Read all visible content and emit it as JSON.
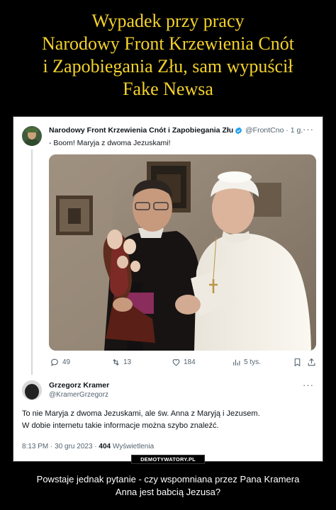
{
  "meme": {
    "title_lines": [
      "Wypadek przy pracy",
      "Narodowy Front Krzewienia Cnót",
      "i Zapobiegania Złu, sam wypuścił",
      "Fake Newsa"
    ],
    "watermark": "DEMOTYWATORY.PL",
    "caption_lines": [
      "Powstaje jednak pytanie - czy wspomniana przez Pana Kramera",
      "Anna jest babcią Jezusa?"
    ]
  },
  "tweet1": {
    "author_name": "Narodowy Front Krzewienia Cnót i Zapobiegania Złu",
    "handle_time": "@FrontCno · 1 g.",
    "more": "···",
    "text": "- Boom! Maryja z dwoma Jezuskami!",
    "stats": {
      "replies": "49",
      "reposts": "13",
      "likes": "184",
      "views": "5 tys."
    },
    "icons": [
      "reply-icon",
      "repost-icon",
      "like-icon",
      "views-icon",
      "bookmark-icon",
      "share-icon"
    ]
  },
  "tweet2": {
    "author_name": "Grzegorz Kramer",
    "handle": "@KramerGrzegorz",
    "more": "···",
    "text_lines": [
      "To nie Maryja z dwoma Jezuskami, ale św. Anna z Maryją i Jezusem.",
      "W dobie internetu takie informacje można szybo znaleźć."
    ],
    "time_date": "8:13 PM · 30 gru 2023 · ",
    "views_count": "404",
    "views_label": " Wyświetlenia"
  },
  "colors": {
    "title": "#f4d22b",
    "verified": "#1d9bf0",
    "muted": "#536471",
    "text": "#0f1419"
  }
}
